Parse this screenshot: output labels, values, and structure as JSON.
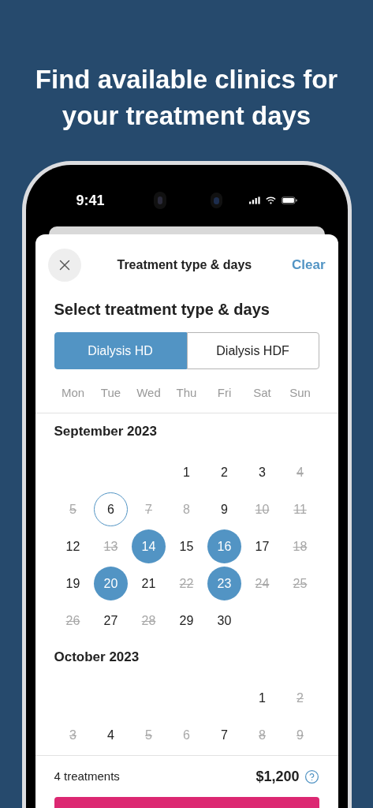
{
  "headline": "Find available clinics for your treatment days",
  "status_bar": {
    "time": "9:41"
  },
  "sheet": {
    "title": "Treatment type & days",
    "clear": "Clear"
  },
  "section_title": "Select treatment type & days",
  "tabs": [
    {
      "label": "Dialysis HD",
      "selected": true
    },
    {
      "label": "Dialysis HDF",
      "selected": false
    }
  ],
  "weekdays": [
    "Mon",
    "Tue",
    "Wed",
    "Thu",
    "Fri",
    "Sat",
    "Sun"
  ],
  "months": [
    {
      "title": "September 2023",
      "weeks": [
        {
          "kind": "first",
          "days": [
            {
              "label": "1",
              "selected": false,
              "today": false,
              "greyed": false,
              "struck": false
            },
            {
              "label": "2",
              "selected": false,
              "today": false,
              "greyed": false,
              "struck": false
            },
            {
              "label": "3",
              "selected": false,
              "today": false,
              "greyed": false,
              "struck": false
            },
            {
              "label": "4",
              "selected": false,
              "today": false,
              "greyed": true,
              "struck": true
            }
          ]
        },
        {
          "kind": "full",
          "days": [
            {
              "label": "5",
              "selected": false,
              "today": false,
              "greyed": true,
              "struck": true
            },
            {
              "label": "6",
              "selected": false,
              "today": true,
              "greyed": false,
              "struck": false
            },
            {
              "label": "7",
              "selected": false,
              "today": false,
              "greyed": true,
              "struck": true
            },
            {
              "label": "8",
              "selected": false,
              "today": false,
              "greyed": true,
              "struck": false
            },
            {
              "label": "9",
              "selected": false,
              "today": false,
              "greyed": false,
              "struck": false
            },
            {
              "label": "10",
              "selected": false,
              "today": false,
              "greyed": true,
              "struck": true
            },
            {
              "label": "11",
              "selected": false,
              "today": false,
              "greyed": true,
              "struck": true
            }
          ]
        },
        {
          "kind": "full",
          "days": [
            {
              "label": "12",
              "selected": false,
              "today": false,
              "greyed": false,
              "struck": false
            },
            {
              "label": "13",
              "selected": false,
              "today": false,
              "greyed": true,
              "struck": true
            },
            {
              "label": "14",
              "selected": true,
              "today": false,
              "greyed": false,
              "struck": false
            },
            {
              "label": "15",
              "selected": false,
              "today": false,
              "greyed": false,
              "struck": false
            },
            {
              "label": "16",
              "selected": true,
              "today": false,
              "greyed": false,
              "struck": false
            },
            {
              "label": "17",
              "selected": false,
              "today": false,
              "greyed": false,
              "struck": false
            },
            {
              "label": "18",
              "selected": false,
              "today": false,
              "greyed": true,
              "struck": true
            }
          ]
        },
        {
          "kind": "full",
          "days": [
            {
              "label": "19",
              "selected": false,
              "today": false,
              "greyed": false,
              "struck": false
            },
            {
              "label": "20",
              "selected": true,
              "today": false,
              "greyed": false,
              "struck": false
            },
            {
              "label": "21",
              "selected": false,
              "today": false,
              "greyed": false,
              "struck": false
            },
            {
              "label": "22",
              "selected": false,
              "today": false,
              "greyed": true,
              "struck": true
            },
            {
              "label": "23",
              "selected": true,
              "today": false,
              "greyed": false,
              "struck": false
            },
            {
              "label": "24",
              "selected": false,
              "today": false,
              "greyed": true,
              "struck": true
            },
            {
              "label": "25",
              "selected": false,
              "today": false,
              "greyed": true,
              "struck": true
            }
          ]
        },
        {
          "kind": "last",
          "days": [
            {
              "label": "26",
              "selected": false,
              "today": false,
              "greyed": true,
              "struck": true
            },
            {
              "label": "27",
              "selected": false,
              "today": false,
              "greyed": false,
              "struck": false
            },
            {
              "label": "28",
              "selected": false,
              "today": false,
              "greyed": true,
              "struck": true
            },
            {
              "label": "29",
              "selected": false,
              "today": false,
              "greyed": false,
              "struck": false
            },
            {
              "label": "30",
              "selected": false,
              "today": false,
              "greyed": false,
              "struck": false
            }
          ]
        }
      ]
    },
    {
      "title": "October 2023",
      "weeks": [
        {
          "kind": "first",
          "days": [
            {
              "label": "1",
              "selected": false,
              "today": false,
              "greyed": false,
              "struck": false
            },
            {
              "label": "2",
              "selected": false,
              "today": false,
              "greyed": true,
              "struck": true
            }
          ]
        },
        {
          "kind": "full",
          "days": [
            {
              "label": "3",
              "selected": false,
              "today": false,
              "greyed": true,
              "struck": true
            },
            {
              "label": "4",
              "selected": false,
              "today": false,
              "greyed": false,
              "struck": false
            },
            {
              "label": "5",
              "selected": false,
              "today": false,
              "greyed": true,
              "struck": true
            },
            {
              "label": "6",
              "selected": false,
              "today": false,
              "greyed": true,
              "struck": false
            },
            {
              "label": "7",
              "selected": false,
              "today": false,
              "greyed": false,
              "struck": false
            },
            {
              "label": "8",
              "selected": false,
              "today": false,
              "greyed": true,
              "struck": true
            },
            {
              "label": "9",
              "selected": false,
              "today": false,
              "greyed": true,
              "struck": true
            }
          ]
        }
      ]
    }
  ],
  "footer": {
    "count": "4 treatments",
    "price": "$1,200"
  }
}
